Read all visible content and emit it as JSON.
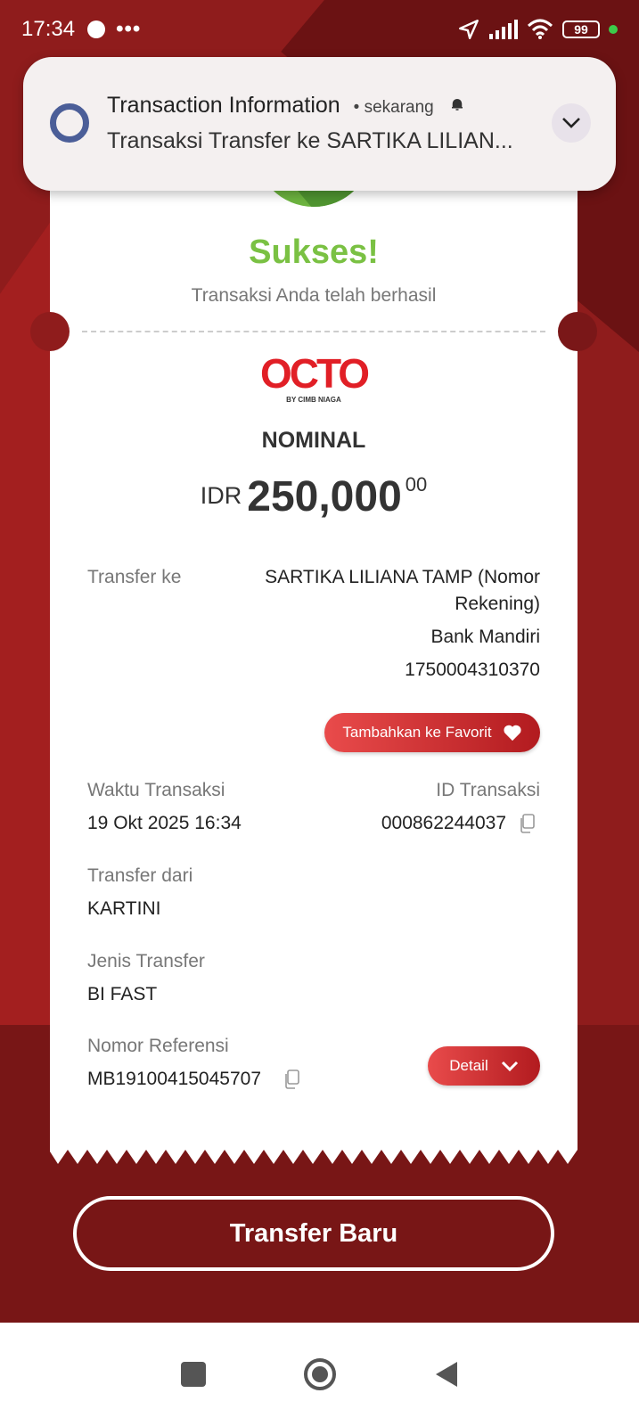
{
  "status_bar": {
    "time": "17:34",
    "more": "•••",
    "battery": "99"
  },
  "notification": {
    "title": "Transaction Information",
    "time": "• sekarang",
    "body": "Transaksi Transfer ke SARTIKA LILIAN..."
  },
  "receipt": {
    "status_title": "Sukses!",
    "status_subtitle": "Transaksi Anda telah berhasil",
    "logo_text": "OCTO",
    "logo_by": "BY CIMB NIAGA",
    "nominal_label": "NOMINAL",
    "currency": "IDR",
    "amount": "250,000",
    "amount_decimal": "00",
    "transfer_to_label": "Transfer ke",
    "recipient_line1": "SARTIKA LILIANA TAMP (Nomor",
    "recipient_line2": "Rekening)",
    "bank": "Bank Mandiri",
    "account_number": "1750004310370",
    "favorite_button": "Tambahkan ke Favorit",
    "time_label": "Waktu Transaksi",
    "time_value": "19 Okt 2025 16:34",
    "id_label": "ID Transaksi",
    "id_value": "000862244037",
    "from_label": "Transfer dari",
    "from_value": "KARTINI",
    "type_label": "Jenis Transfer",
    "type_value": "BI FAST",
    "ref_label": "Nomor Referensi",
    "ref_value": "MB19100415045707",
    "detail_button": "Detail"
  },
  "actions": {
    "new_transfer": "Transfer Baru"
  },
  "colors": {
    "success": "#7ac143",
    "brand": "#e11f26",
    "background": "#8f1c1c"
  }
}
